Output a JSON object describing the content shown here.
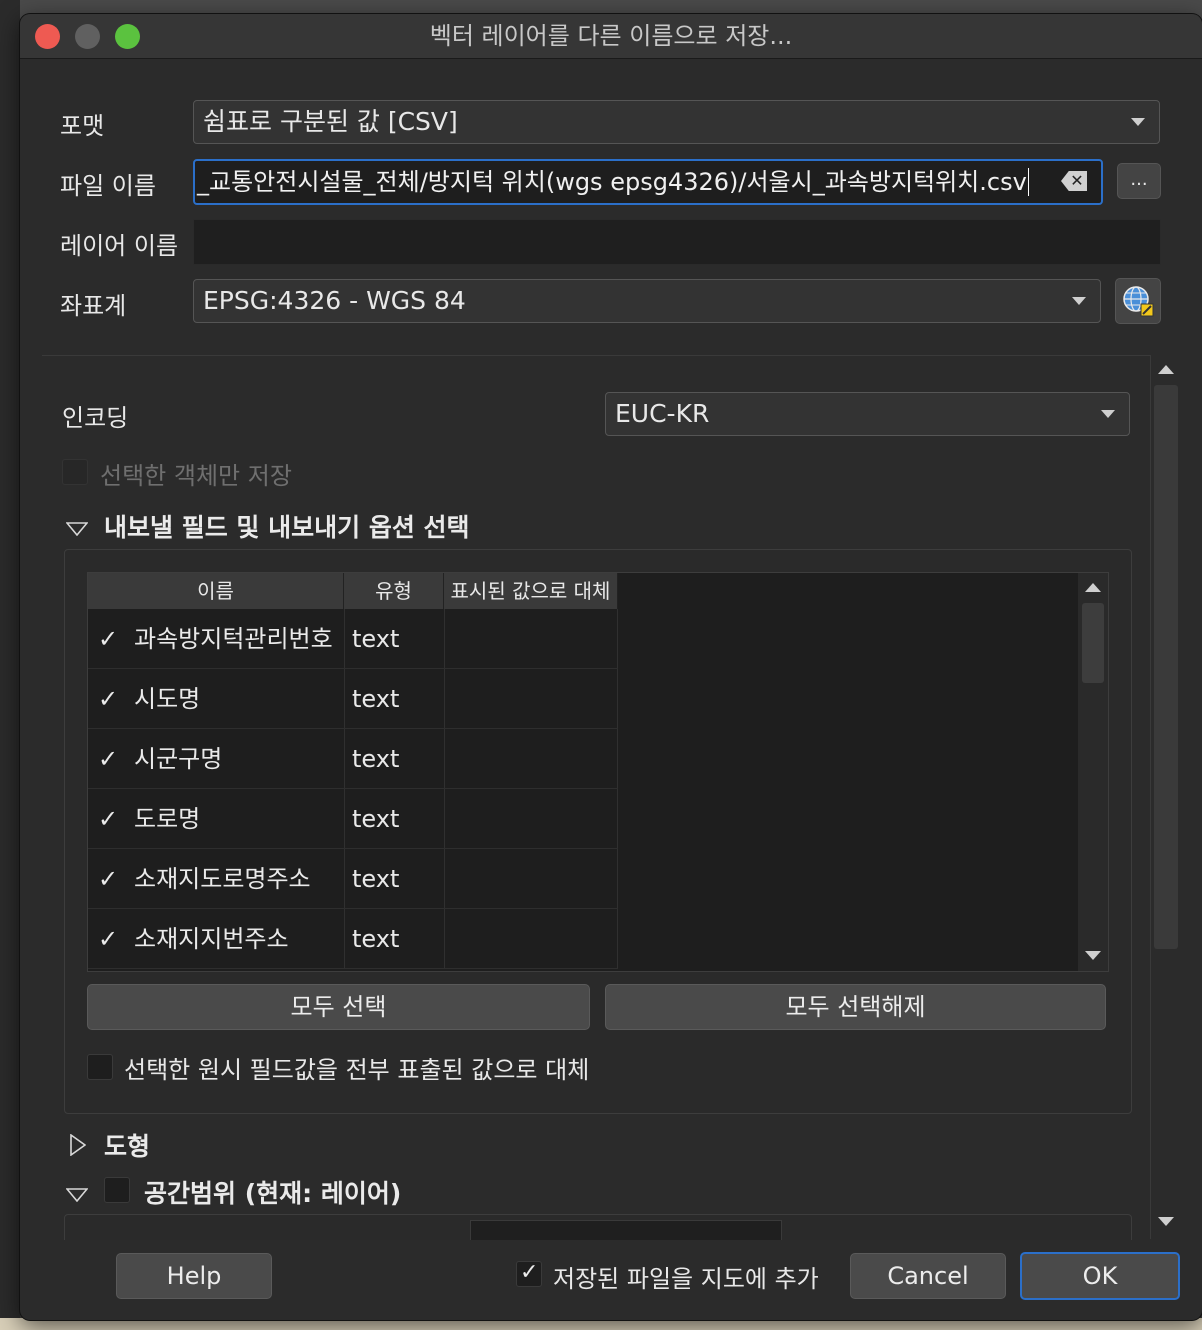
{
  "window": {
    "title": "벡터 레이어를 다른 이름으로 저장..."
  },
  "form": {
    "format_label": "포맷",
    "format_value": "쉼표로 구분된 값 [CSV]",
    "filename_label": "파일 이름",
    "filename_value": "_교통안전시설물_전체/방지턱 위치(wgs epsg4326)/서울시_과속방지턱위치.csv",
    "browse_label": "...",
    "layername_label": "레이어 이름",
    "layername_value": "",
    "crs_label": "좌표계",
    "crs_value": "EPSG:4326 - WGS 84"
  },
  "options": {
    "encoding_label": "인코딩",
    "encoding_value": "EUC-KR",
    "selected_only_label": "선택한 객체만 저장",
    "fields_section_title": "내보낼 필드 및 내보내기 옵션 선택",
    "columns": [
      "이름",
      "유형",
      "표시된 값으로 대체"
    ],
    "fields": [
      {
        "checked": true,
        "name": "과속방지턱관리번호",
        "type": "text"
      },
      {
        "checked": true,
        "name": "시도명",
        "type": "text"
      },
      {
        "checked": true,
        "name": "시군구명",
        "type": "text"
      },
      {
        "checked": true,
        "name": "도로명",
        "type": "text"
      },
      {
        "checked": true,
        "name": "소재지도로명주소",
        "type": "text"
      },
      {
        "checked": true,
        "name": "소재지지번주소",
        "type": "text"
      }
    ],
    "select_all_label": "모두 선택",
    "deselect_all_label": "모두 선택해제",
    "replace_all_label": "선택한 원시 필드값을 전부 표출된 값으로 대체",
    "geometry_section_title": "도형",
    "extent_section_title": "공간범위 (현재: 레이어)"
  },
  "footer": {
    "help_label": "Help",
    "add_to_map_label": "저장된 파일을 지도에 추가",
    "add_to_map_checked": true,
    "cancel_label": "Cancel",
    "ok_label": "OK"
  },
  "icons": [
    "close-traffic-light",
    "minimize-traffic-light",
    "maximize-traffic-light",
    "clear-icon",
    "crs-globe-icon",
    "chevron-down-icon",
    "scroll-up-icon",
    "scroll-down-icon"
  ]
}
